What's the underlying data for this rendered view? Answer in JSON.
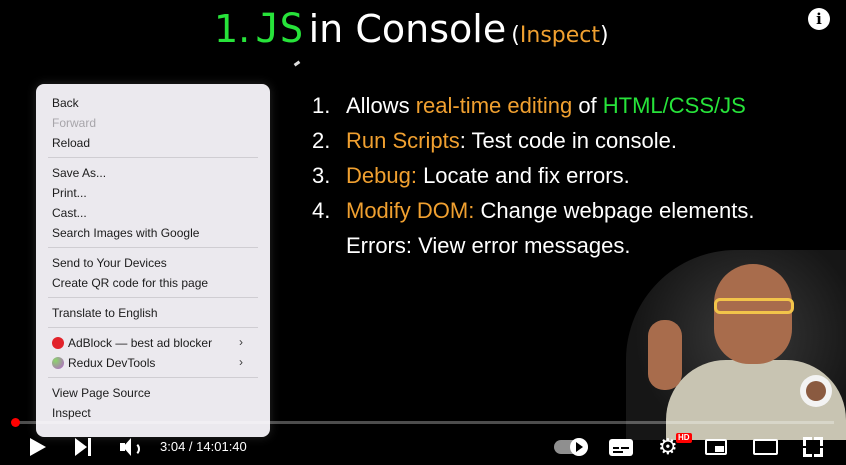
{
  "slide": {
    "title_num": "1.",
    "title_js": "JS",
    "title_rest": "in Console",
    "title_paren_open": "(",
    "title_inspect": "Inspect",
    "title_paren_close": ")",
    "points": [
      {
        "num": "1.",
        "pre": "Allows ",
        "hl_orange": "real-time editing",
        "mid": " of ",
        "hl_green": "HTML/CSS/JS"
      },
      {
        "num": "2.",
        "hl_orange": "Run Scripts",
        "rest": ": Test code in console."
      },
      {
        "num": "3.",
        "hl_orange": "Debug:",
        "rest": " Locate and fix errors."
      },
      {
        "num": "4.",
        "hl_orange": "Modify DOM:",
        "rest": " Change webpage elements."
      },
      {
        "num": "",
        "rest": "Errors: View error messages."
      }
    ]
  },
  "context_menu": {
    "items": {
      "back": "Back",
      "forward": "Forward",
      "reload": "Reload",
      "save_as": "Save As...",
      "print": "Print...",
      "cast": "Cast...",
      "search_images": "Search Images with Google",
      "send_devices": "Send to Your Devices",
      "qr_code": "Create QR code for this page",
      "translate": "Translate to English",
      "adblock": "AdBlock — best ad blocker",
      "redux": "Redux DevTools",
      "view_source": "View Page Source",
      "inspect": "Inspect"
    },
    "submenu_arrow": "›"
  },
  "player": {
    "current_time": "3:04",
    "separator": " / ",
    "duration": "14:01:40",
    "progress_fraction": 0.0036,
    "hd_badge": "HD",
    "accent_color": "#ff0000",
    "info_icon": "i"
  },
  "colors": {
    "green": "#27e33a",
    "orange": "#f0a030",
    "menu_bg": "#ebe9ee"
  }
}
